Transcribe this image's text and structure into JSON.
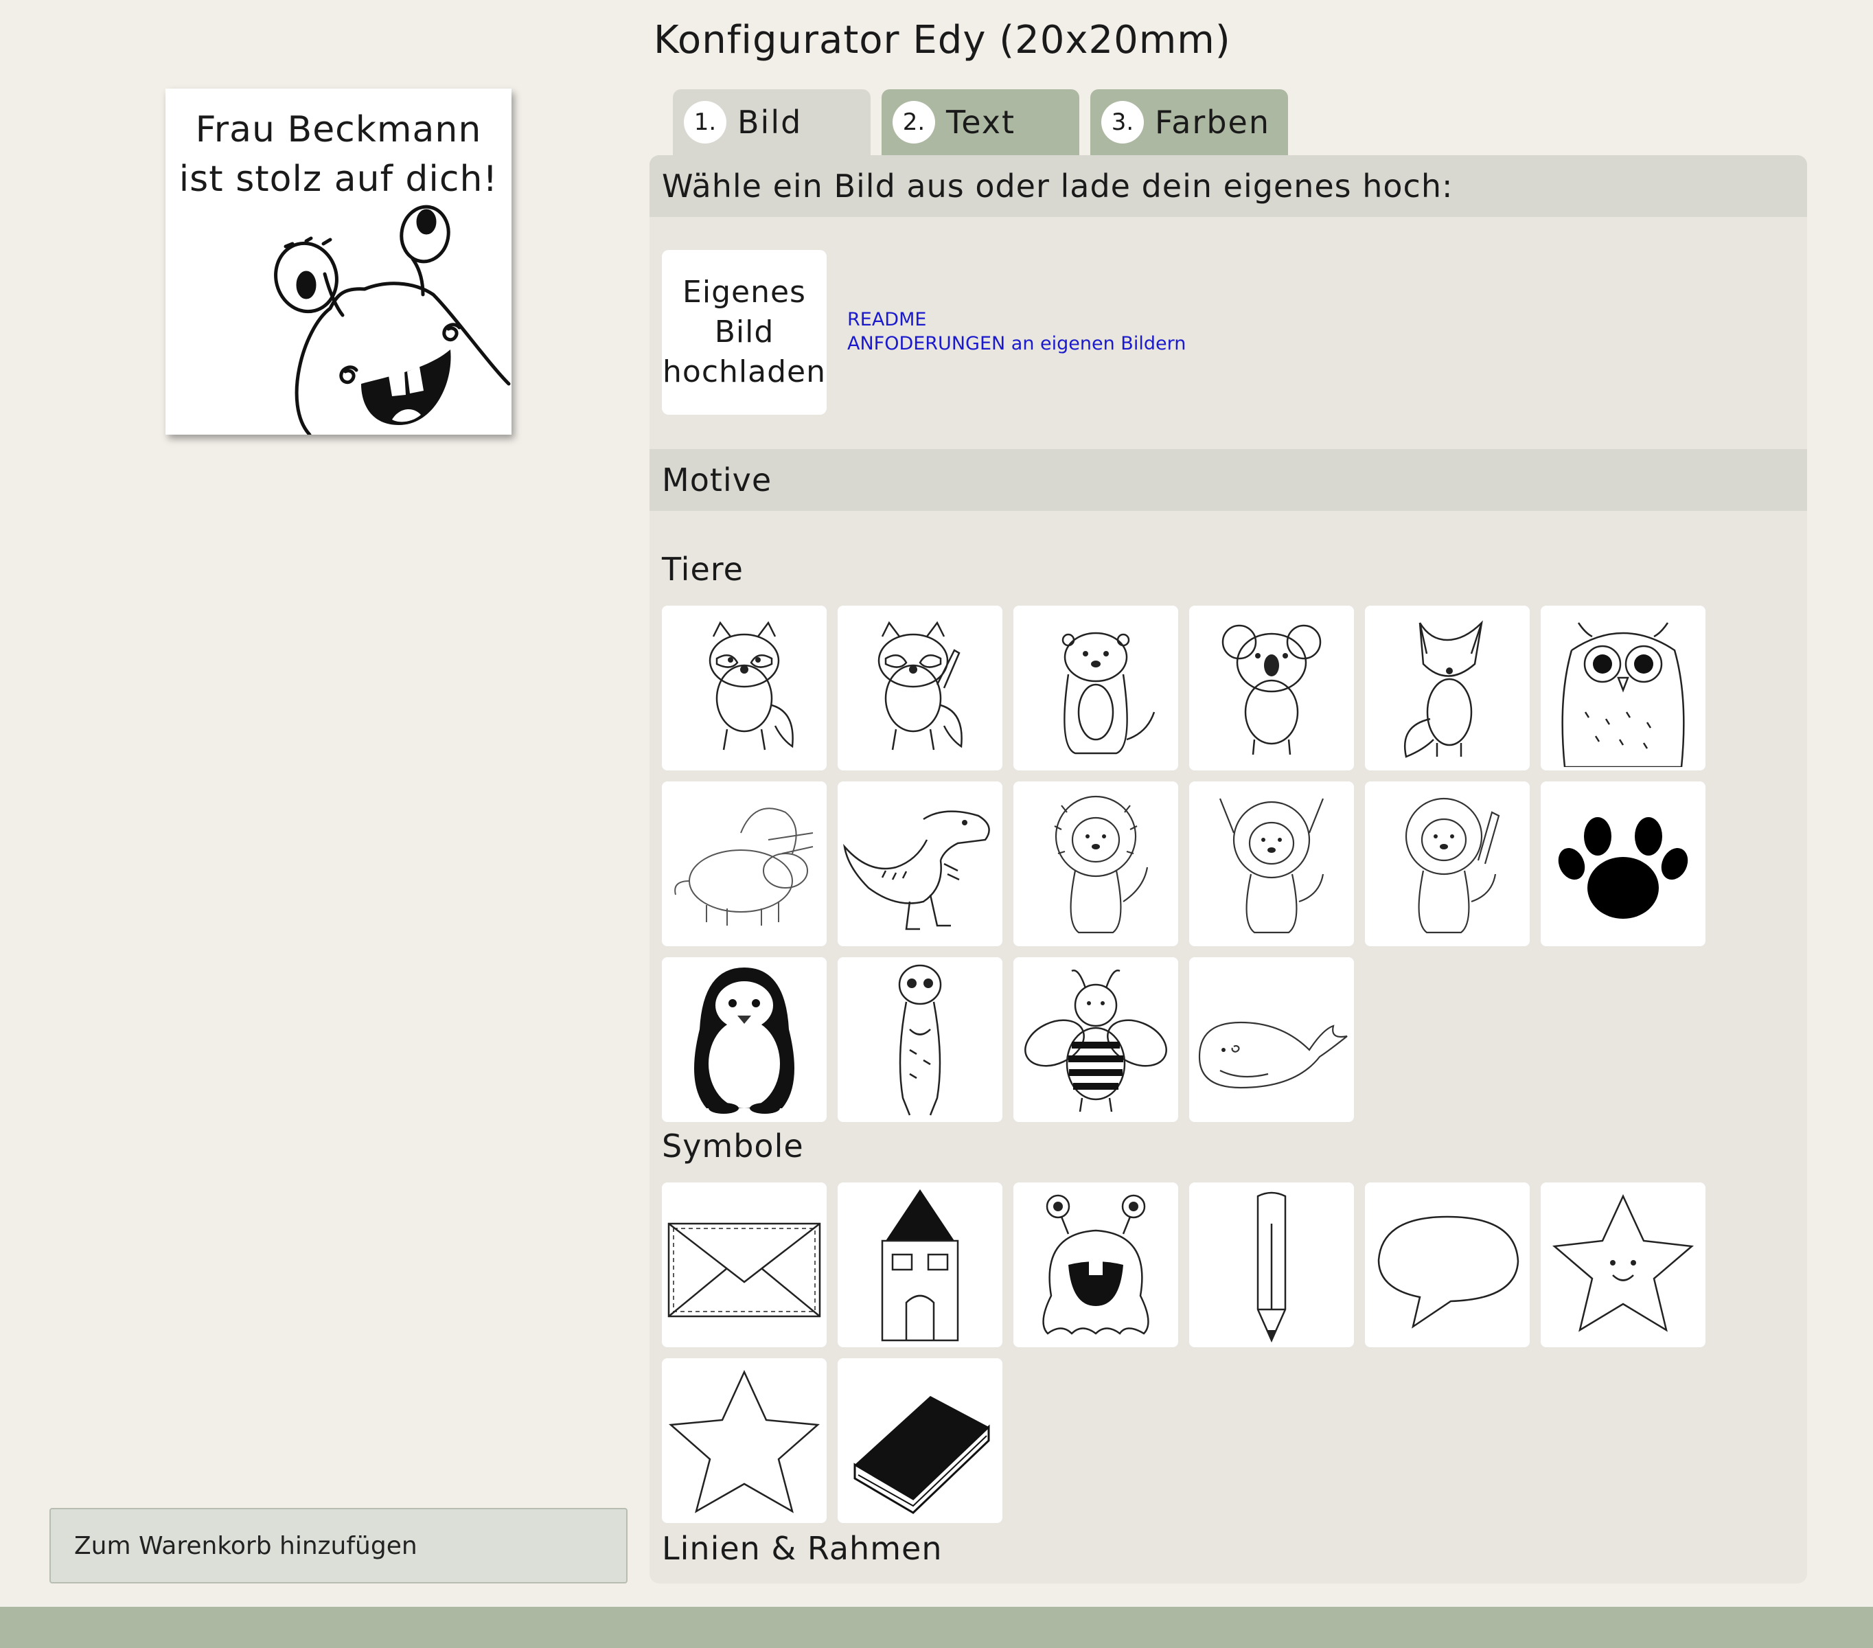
{
  "page": {
    "title": "Konfigurator Edy (20x20mm)"
  },
  "preview": {
    "line1": "Frau Beckmann",
    "line2": "ist stolz auf dich!",
    "motif_icon": "monster-icon"
  },
  "cart": {
    "label": "Zum Warenkorb hinzufügen"
  },
  "tabs": [
    {
      "num": "1.",
      "label": "Bild",
      "active": true
    },
    {
      "num": "2.",
      "label": "Text",
      "active": false
    },
    {
      "num": "3.",
      "label": "Farben",
      "active": false
    }
  ],
  "image_section": {
    "heading": "Wähle ein Bild aus oder lade dein eigenes hoch:",
    "upload": {
      "line1": "Eigenes",
      "line2": "Bild",
      "line3": "hochladen"
    },
    "readme_link": "README",
    "requirements_link": "ANFODERUNGEN an eigenen Bildern"
  },
  "motifs": {
    "heading": "Motive",
    "categories": [
      {
        "title": "Tiere",
        "items": [
          "raccoon-icon",
          "raccoon-waving-icon",
          "otter-icon",
          "koala-icon",
          "fox-icon",
          "owl-icon",
          "triceratops-icon",
          "t-rex-icon",
          "lion-icon",
          "lion-arms-up-icon",
          "lion-waving-icon",
          "paw-icon",
          "penguin-icon",
          "meerkat-icon",
          "bee-icon",
          "whale-icon"
        ]
      },
      {
        "title": "Symbole",
        "items": [
          "envelope-icon",
          "house-icon",
          "monster-icon",
          "pencil-icon",
          "speech-bubble-icon",
          "smiling-star-icon",
          "star-icon",
          "book-icon"
        ]
      },
      {
        "title": "Linien & Rahmen",
        "items": []
      }
    ]
  },
  "colors": {
    "background": "#f2eee8",
    "panel": "#e8e6df",
    "section_header": "#d8d8d0",
    "tab_inactive": "#adb8a2",
    "link": "#1a1acc"
  }
}
